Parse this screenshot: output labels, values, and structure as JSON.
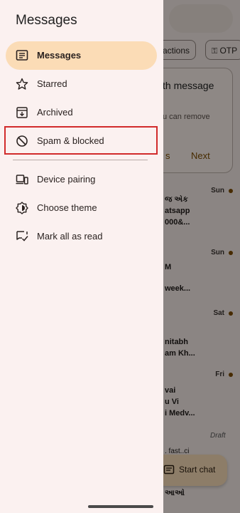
{
  "background": {
    "chips": [
      "actions",
      "OTP"
    ],
    "card": {
      "title": "th message",
      "subtitle": "u can remove",
      "dismiss": "s",
      "next": "Next"
    },
    "conversations": [
      {
        "day": "Sun",
        "lines": [
          "જ એક",
          "atsapp",
          "000&..."
        ]
      },
      {
        "day": "Sun",
        "lines": [
          "M",
          "week..."
        ]
      },
      {
        "day": "Sat",
        "lines": [
          "nitabh",
          "am Kh..."
        ]
      },
      {
        "day": "Fri",
        "lines": [
          "vai",
          "u Vi",
          "i Medv..."
        ]
      }
    ],
    "draft_label": "Draft",
    "peek_lines": [
      ". fast..ci",
      "આઓ"
    ],
    "fab_label": "Start chat"
  },
  "drawer": {
    "title": "Messages",
    "items": [
      {
        "label": "Messages",
        "icon": "messages-icon",
        "active": true
      },
      {
        "label": "Starred",
        "icon": "star-icon"
      },
      {
        "label": "Archived",
        "icon": "archive-icon"
      },
      {
        "label": "Spam & blocked",
        "icon": "block-icon",
        "highlighted": true
      },
      {
        "label": "Device pairing",
        "icon": "devices-icon"
      },
      {
        "label": "Choose theme",
        "icon": "theme-icon"
      },
      {
        "label": "Mark all as read",
        "icon": "mark-read-icon"
      }
    ]
  },
  "colors": {
    "drawer_bg": "#fbf1f0",
    "active_pill": "#fbdcb6",
    "highlight_border": "#d12b2b",
    "accent": "#7a4a00"
  }
}
